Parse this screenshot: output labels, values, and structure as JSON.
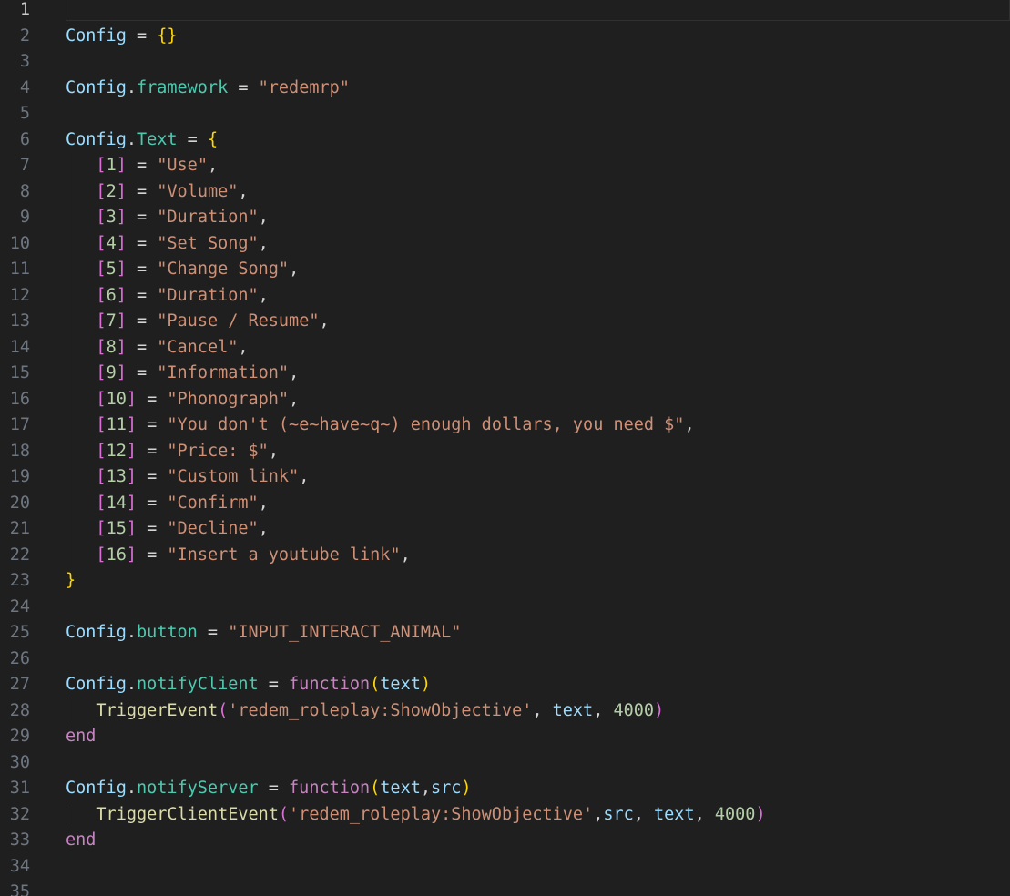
{
  "editor": {
    "active_line": 1,
    "lines": [
      {
        "n": "1",
        "t": []
      },
      {
        "n": "2",
        "t": [
          [
            "var",
            "Config"
          ],
          [
            "op",
            " = "
          ],
          [
            "b1",
            "{}"
          ]
        ]
      },
      {
        "n": "3",
        "t": []
      },
      {
        "n": "4",
        "t": [
          [
            "var",
            "Config"
          ],
          [
            "op",
            "."
          ],
          [
            "prop",
            "framework"
          ],
          [
            "op",
            " = "
          ],
          [
            "str",
            "\"redemrp\""
          ]
        ]
      },
      {
        "n": "5",
        "t": []
      },
      {
        "n": "6",
        "t": [
          [
            "var",
            "Config"
          ],
          [
            "op",
            "."
          ],
          [
            "prop",
            "Text"
          ],
          [
            "op",
            " = "
          ],
          [
            "b1",
            "{"
          ]
        ]
      },
      {
        "n": "7",
        "t": [
          [
            "op",
            "   "
          ],
          [
            "b2",
            "["
          ],
          [
            "num",
            "1"
          ],
          [
            "b2",
            "]"
          ],
          [
            "op",
            " = "
          ],
          [
            "str",
            "\"Use\""
          ],
          [
            "op",
            ","
          ]
        ]
      },
      {
        "n": "8",
        "t": [
          [
            "op",
            "   "
          ],
          [
            "b2",
            "["
          ],
          [
            "num",
            "2"
          ],
          [
            "b2",
            "]"
          ],
          [
            "op",
            " = "
          ],
          [
            "str",
            "\"Volume\""
          ],
          [
            "op",
            ","
          ]
        ]
      },
      {
        "n": "9",
        "t": [
          [
            "op",
            "   "
          ],
          [
            "b2",
            "["
          ],
          [
            "num",
            "3"
          ],
          [
            "b2",
            "]"
          ],
          [
            "op",
            " = "
          ],
          [
            "str",
            "\"Duration\""
          ],
          [
            "op",
            ","
          ]
        ]
      },
      {
        "n": "10",
        "t": [
          [
            "op",
            "   "
          ],
          [
            "b2",
            "["
          ],
          [
            "num",
            "4"
          ],
          [
            "b2",
            "]"
          ],
          [
            "op",
            " = "
          ],
          [
            "str",
            "\"Set Song\""
          ],
          [
            "op",
            ","
          ]
        ]
      },
      {
        "n": "11",
        "t": [
          [
            "op",
            "   "
          ],
          [
            "b2",
            "["
          ],
          [
            "num",
            "5"
          ],
          [
            "b2",
            "]"
          ],
          [
            "op",
            " = "
          ],
          [
            "str",
            "\"Change Song\""
          ],
          [
            "op",
            ","
          ]
        ]
      },
      {
        "n": "12",
        "t": [
          [
            "op",
            "   "
          ],
          [
            "b2",
            "["
          ],
          [
            "num",
            "6"
          ],
          [
            "b2",
            "]"
          ],
          [
            "op",
            " = "
          ],
          [
            "str",
            "\"Duration\""
          ],
          [
            "op",
            ","
          ]
        ]
      },
      {
        "n": "13",
        "t": [
          [
            "op",
            "   "
          ],
          [
            "b2",
            "["
          ],
          [
            "num",
            "7"
          ],
          [
            "b2",
            "]"
          ],
          [
            "op",
            " = "
          ],
          [
            "str",
            "\"Pause / Resume\""
          ],
          [
            "op",
            ","
          ]
        ]
      },
      {
        "n": "14",
        "t": [
          [
            "op",
            "   "
          ],
          [
            "b2",
            "["
          ],
          [
            "num",
            "8"
          ],
          [
            "b2",
            "]"
          ],
          [
            "op",
            " = "
          ],
          [
            "str",
            "\"Cancel\""
          ],
          [
            "op",
            ","
          ]
        ]
      },
      {
        "n": "15",
        "t": [
          [
            "op",
            "   "
          ],
          [
            "b2",
            "["
          ],
          [
            "num",
            "9"
          ],
          [
            "b2",
            "]"
          ],
          [
            "op",
            " = "
          ],
          [
            "str",
            "\"Information\""
          ],
          [
            "op",
            ","
          ]
        ]
      },
      {
        "n": "16",
        "t": [
          [
            "op",
            "   "
          ],
          [
            "b2",
            "["
          ],
          [
            "num",
            "10"
          ],
          [
            "b2",
            "]"
          ],
          [
            "op",
            " = "
          ],
          [
            "str",
            "\"Phonograph\""
          ],
          [
            "op",
            ","
          ]
        ]
      },
      {
        "n": "17",
        "t": [
          [
            "op",
            "   "
          ],
          [
            "b2",
            "["
          ],
          [
            "num",
            "11"
          ],
          [
            "b2",
            "]"
          ],
          [
            "op",
            " = "
          ],
          [
            "str",
            "\"You don't (~e~have~q~) enough dollars, you need $\""
          ],
          [
            "op",
            ","
          ]
        ]
      },
      {
        "n": "18",
        "t": [
          [
            "op",
            "   "
          ],
          [
            "b2",
            "["
          ],
          [
            "num",
            "12"
          ],
          [
            "b2",
            "]"
          ],
          [
            "op",
            " = "
          ],
          [
            "str",
            "\"Price: $\""
          ],
          [
            "op",
            ","
          ]
        ]
      },
      {
        "n": "19",
        "t": [
          [
            "op",
            "   "
          ],
          [
            "b2",
            "["
          ],
          [
            "num",
            "13"
          ],
          [
            "b2",
            "]"
          ],
          [
            "op",
            " = "
          ],
          [
            "str",
            "\"Custom link\""
          ],
          [
            "op",
            ","
          ]
        ]
      },
      {
        "n": "20",
        "t": [
          [
            "op",
            "   "
          ],
          [
            "b2",
            "["
          ],
          [
            "num",
            "14"
          ],
          [
            "b2",
            "]"
          ],
          [
            "op",
            " = "
          ],
          [
            "str",
            "\"Confirm\""
          ],
          [
            "op",
            ","
          ]
        ]
      },
      {
        "n": "21",
        "t": [
          [
            "op",
            "   "
          ],
          [
            "b2",
            "["
          ],
          [
            "num",
            "15"
          ],
          [
            "b2",
            "]"
          ],
          [
            "op",
            " = "
          ],
          [
            "str",
            "\"Decline\""
          ],
          [
            "op",
            ","
          ]
        ]
      },
      {
        "n": "22",
        "t": [
          [
            "op",
            "   "
          ],
          [
            "b2",
            "["
          ],
          [
            "num",
            "16"
          ],
          [
            "b2",
            "]"
          ],
          [
            "op",
            " = "
          ],
          [
            "str",
            "\"Insert a youtube link\""
          ],
          [
            "op",
            ","
          ]
        ]
      },
      {
        "n": "23",
        "t": [
          [
            "b1",
            "}"
          ]
        ]
      },
      {
        "n": "24",
        "t": []
      },
      {
        "n": "25",
        "t": [
          [
            "var",
            "Config"
          ],
          [
            "op",
            "."
          ],
          [
            "prop",
            "button"
          ],
          [
            "op",
            " = "
          ],
          [
            "str",
            "\"INPUT_INTERACT_ANIMAL\""
          ]
        ]
      },
      {
        "n": "26",
        "t": []
      },
      {
        "n": "27",
        "t": [
          [
            "var",
            "Config"
          ],
          [
            "op",
            "."
          ],
          [
            "prop",
            "notifyClient"
          ],
          [
            "op",
            " = "
          ],
          [
            "kw",
            "function"
          ],
          [
            "b1",
            "("
          ],
          [
            "var",
            "text"
          ],
          [
            "b1",
            ")"
          ]
        ]
      },
      {
        "n": "28",
        "t": [
          [
            "op",
            "   "
          ],
          [
            "func",
            "TriggerEvent"
          ],
          [
            "b2",
            "("
          ],
          [
            "str",
            "'redem_roleplay:ShowObjective'"
          ],
          [
            "op",
            ", "
          ],
          [
            "var",
            "text"
          ],
          [
            "op",
            ", "
          ],
          [
            "num",
            "4000"
          ],
          [
            "b2",
            ")"
          ]
        ]
      },
      {
        "n": "29",
        "t": [
          [
            "kw",
            "end"
          ]
        ]
      },
      {
        "n": "30",
        "t": []
      },
      {
        "n": "31",
        "t": [
          [
            "var",
            "Config"
          ],
          [
            "op",
            "."
          ],
          [
            "prop",
            "notifyServer"
          ],
          [
            "op",
            " = "
          ],
          [
            "kw",
            "function"
          ],
          [
            "b1",
            "("
          ],
          [
            "var",
            "text"
          ],
          [
            "op",
            ","
          ],
          [
            "var",
            "src"
          ],
          [
            "b1",
            ")"
          ]
        ]
      },
      {
        "n": "32",
        "t": [
          [
            "op",
            "   "
          ],
          [
            "func",
            "TriggerClientEvent"
          ],
          [
            "b2",
            "("
          ],
          [
            "str",
            "'redem_roleplay:ShowObjective'"
          ],
          [
            "op",
            ","
          ],
          [
            "var",
            "src"
          ],
          [
            "op",
            ", "
          ],
          [
            "var",
            "text"
          ],
          [
            "op",
            ", "
          ],
          [
            "num",
            "4000"
          ],
          [
            "b2",
            ")"
          ]
        ]
      },
      {
        "n": "33",
        "t": [
          [
            "kw",
            "end"
          ]
        ]
      },
      {
        "n": "34",
        "t": []
      },
      {
        "n": "35",
        "t": []
      }
    ]
  },
  "theme": {
    "background": "#1f1f1f",
    "variable": "#9cdcfe",
    "property": "#4ec9b0",
    "function": "#dcdcaa",
    "keyword": "#c586c0",
    "string": "#ce9178",
    "number": "#b5cea8",
    "bracket_1": "#ffd700",
    "bracket_2": "#da70d6"
  }
}
